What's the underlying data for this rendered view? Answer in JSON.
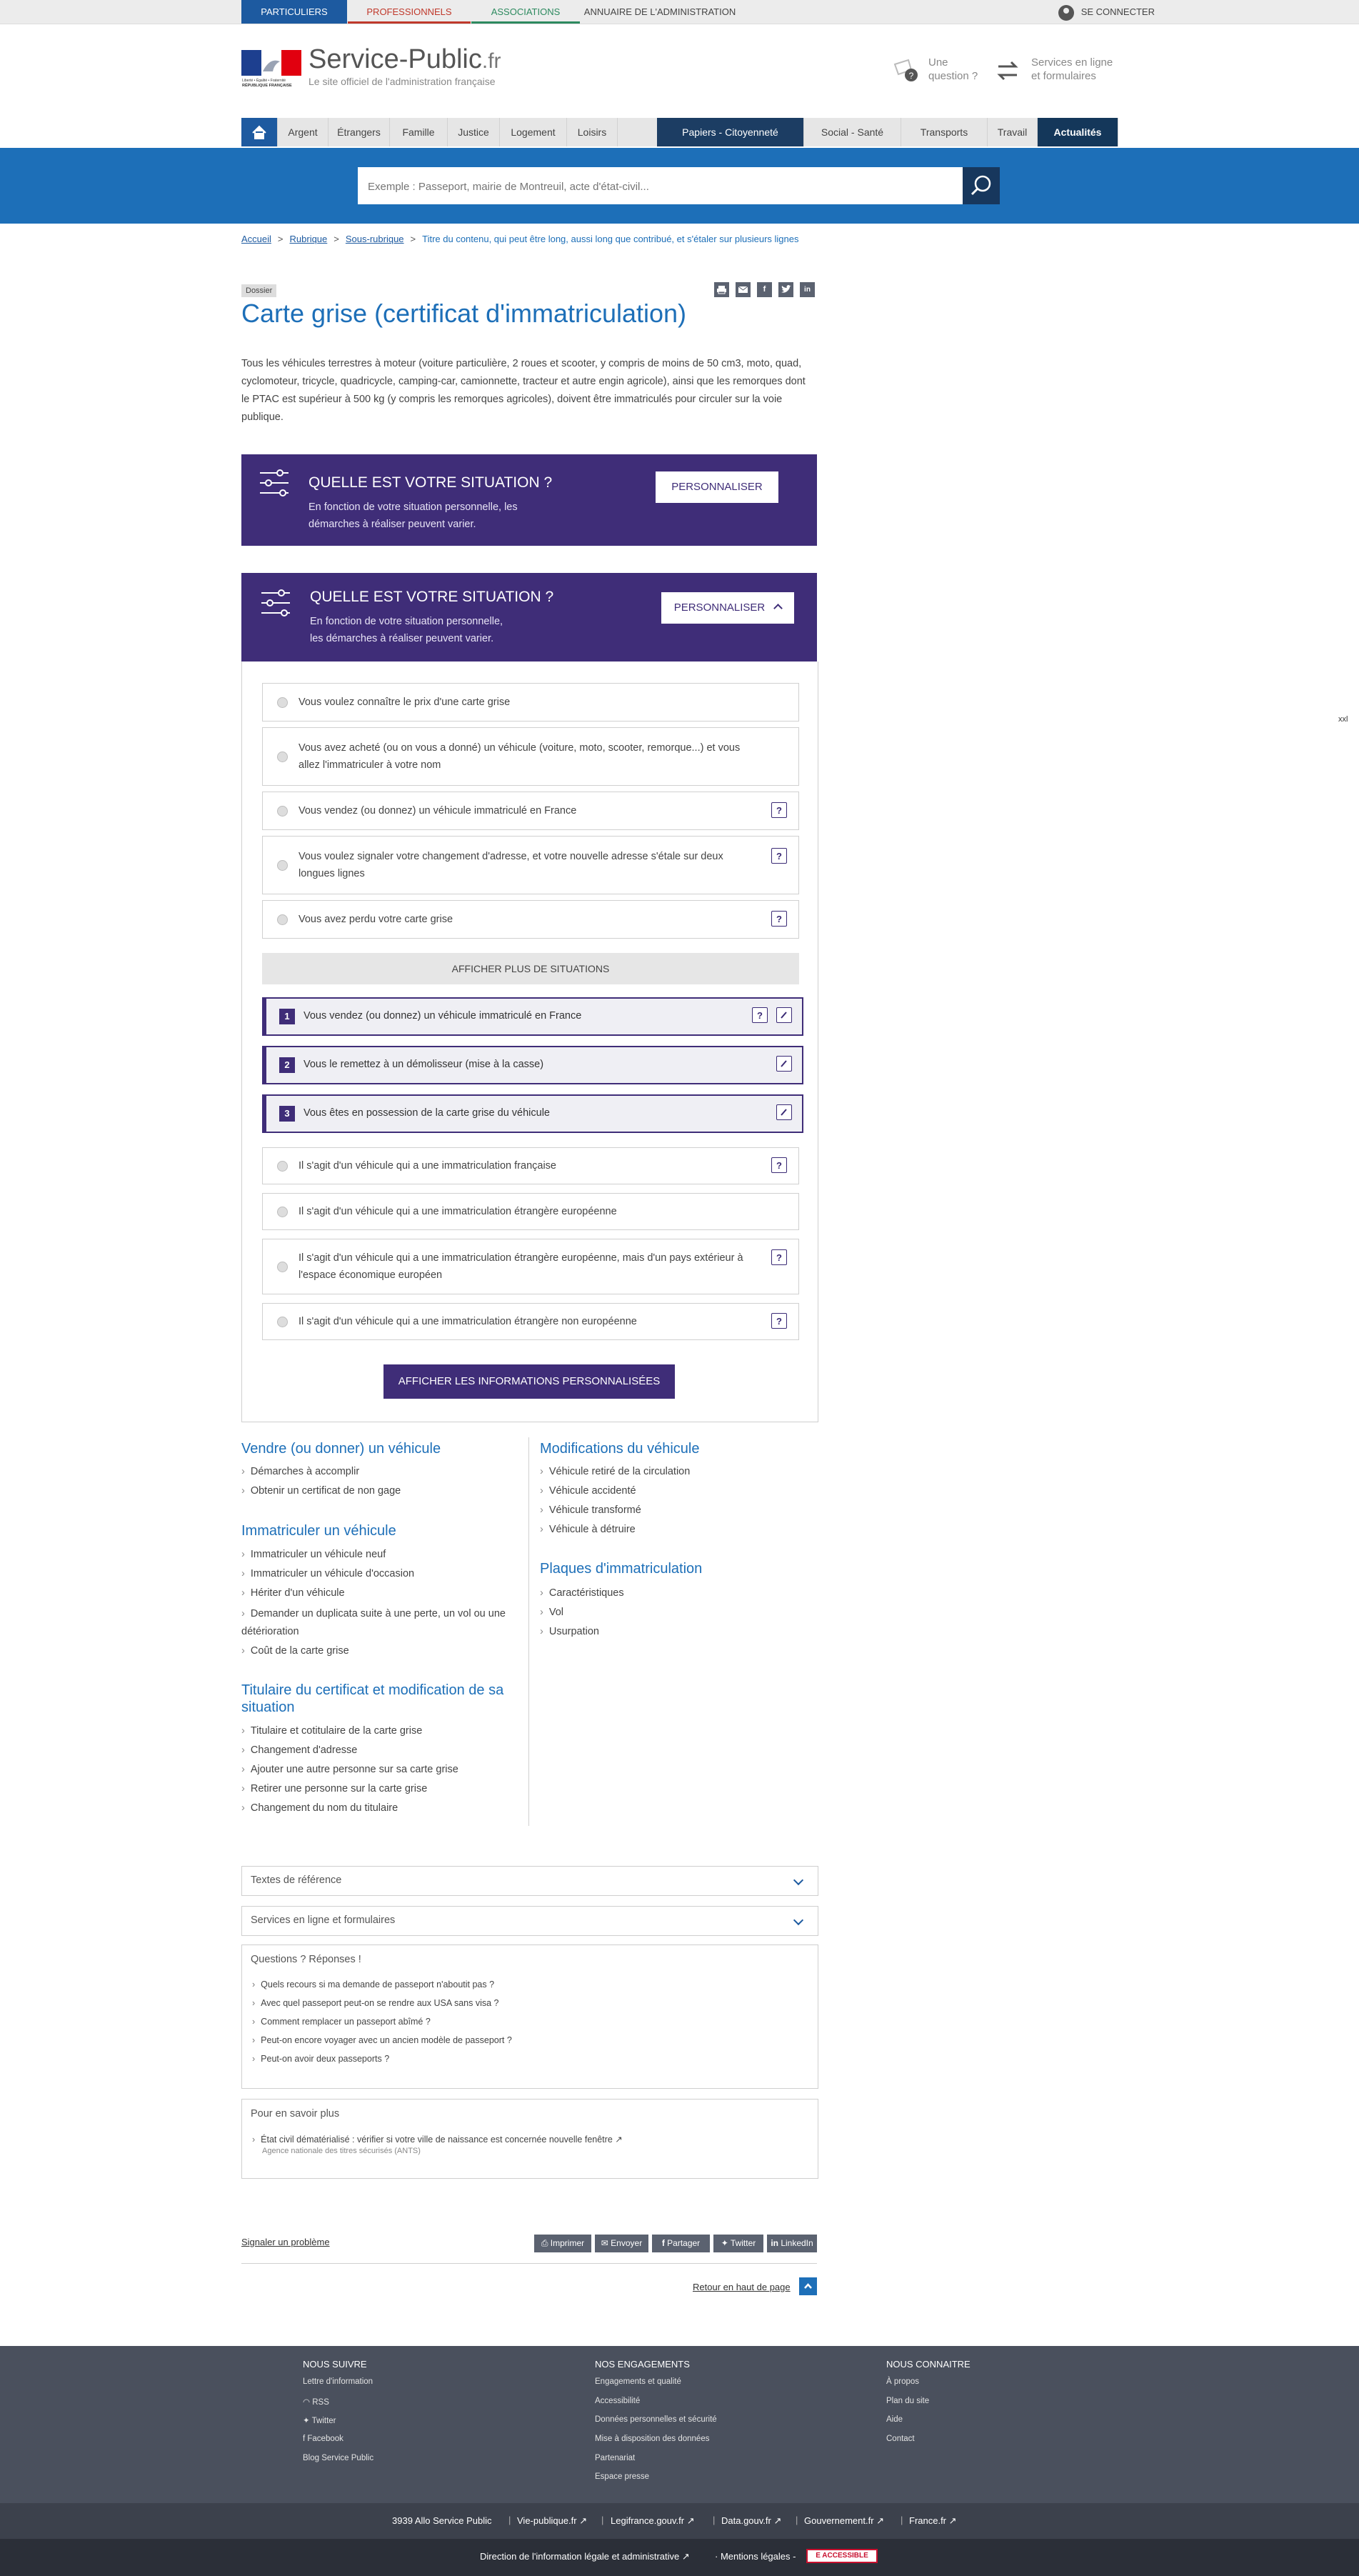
{
  "topbar": {
    "tabs": [
      "PARTICULIERS",
      "PROFESSIONNELS",
      "ASSOCIATIONS",
      "ANNUAIRE DE L'ADMINISTRATION"
    ],
    "login": "SE CONNECTER"
  },
  "header": {
    "site_name": "Service-Public",
    "site_tld": ".fr",
    "tagline": "Le site officiel de l'administration française",
    "marianne_text": "Liberté • Égalité • Fraternité\nRÉPUBLIQUE FRANÇAISE",
    "question_link": "Une question ?",
    "services_link": "Services en ligne et formulaires"
  },
  "nav": [
    "Argent",
    "Étrangers",
    "Famille",
    "Justice",
    "Logement",
    "Loisirs",
    "Papiers - Citoyenneté",
    "Social - Santé",
    "Transports",
    "Travail",
    "Actualités"
  ],
  "search": {
    "placeholder": "Exemple : Passeport, mairie de Montreuil, acte d'état-civil..."
  },
  "breadcrumb": {
    "items": [
      "Accueil",
      "Rubrique",
      "Sous-rubrique"
    ],
    "current": "Titre du contenu, qui peut être long, aussi long que contribué, et s'étaler sur plusieurs lignes"
  },
  "page": {
    "tag": "Dossier",
    "title": "Carte grise (certificat d'immatriculation)",
    "intro": "Tous les véhicules terrestres à moteur (voiture particulière, 2 roues et scooter, y compris de moins de 50 cm3, moto, quad, cyclomoteur, tricycle, quadricycle, camping-car, camionnette, tracteur et autre engin agricole), ainsi que les remorques dont le PTAC est supérieur à 500 kg (y compris les remorques agricoles), doivent être immatriculés pour circuler sur la voie publique.",
    "text_size": "xxl"
  },
  "situation_panel": {
    "title": "QUELLE EST VOTRE SITUATION ?",
    "text_line1": "En fonction de votre situation personnelle, les",
    "text_line2": "démarches à réaliser peuvent varier.",
    "button": "PERSONNALISER"
  },
  "situation_panel_open": {
    "title": "QUELLE EST VOTRE SITUATION ?",
    "text_line1": "En fonction de votre situation personnelle,",
    "text_line2": "les démarches à réaliser peuvent varier.",
    "button": "PERSONNALISER"
  },
  "options": [
    "Vous voulez connaître le prix d'une carte grise",
    "Vous avez acheté (ou on vous a donné) un véhicule (voiture, moto, scooter, remorque...) et vous allez l'immatriculer à votre nom",
    "Vous vendez (ou donnez) un véhicule immatriculé en France",
    "Vous voulez signaler votre changement d'adresse, et votre nouvelle adresse s'étale sur deux longues lignes",
    "Vous avez perdu votre carte grise"
  ],
  "more_situations": "AFFICHER PLUS DE SITUATIONS",
  "selected": [
    {
      "num": "1",
      "text": "Vous vendez (ou donnez) un véhicule immatriculé en France"
    },
    {
      "num": "2",
      "text": "Vous le remettez à un démolisseur (mise à la casse)"
    },
    {
      "num": "3",
      "text": "Vous êtes en possession de la carte grise du véhicule"
    }
  ],
  "sub_options": [
    "Il s'agit d'un véhicule qui a une immatriculation française",
    "Il s'agit d'un véhicule qui a une immatriculation étrangère européenne",
    "Il s'agit d'un véhicule qui a une immatriculation étrangère européenne, mais d'un pays extérieur à l'espace économique européen",
    "Il s'agit d'un véhicule qui a une immatriculation étrangère non européenne"
  ],
  "show_info": "AFFICHER LES INFORMATIONS PERSONNALISÉES",
  "icons": {
    "help": "?",
    "edit": "pencil-icon"
  },
  "sections_left": [
    {
      "title": "Vendre (ou donner) un véhicule",
      "links": [
        "Démarches à accomplir",
        "Obtenir un certificat de non gage"
      ]
    },
    {
      "title": "Immatriculer un véhicule",
      "links": [
        "Immatriculer un véhicule neuf",
        "Immatriculer un véhicule d'occasion",
        "Hériter d'un véhicule",
        "Demander un duplicata suite à une perte, un vol ou une détérioration",
        "Coût de la carte grise"
      ]
    },
    {
      "title": "Titulaire du certificat et modification de sa situation",
      "links": [
        "Titulaire et cotitulaire de la carte grise",
        "Changement d'adresse",
        "Ajouter une autre personne sur sa carte grise",
        "Retirer une personne sur la carte grise",
        "Changement du nom du titulaire"
      ]
    }
  ],
  "sections_right": [
    {
      "title": "Modifications du véhicule",
      "links": [
        "Véhicule retiré de la circulation",
        "Véhicule accidenté",
        "Véhicule transformé",
        "Véhicule à détruire"
      ]
    },
    {
      "title": "Plaques d'immatriculation",
      "links": [
        "Caractéristiques",
        "Vol",
        "Usurpation"
      ]
    }
  ],
  "accordions": [
    "Textes de référence",
    "Services en ligne et formulaires"
  ],
  "qa": {
    "title": "Questions ? Réponses !",
    "items": [
      "Quels recours si ma demande de passeport n'aboutit pas ?",
      "Avec quel passeport peut-on se rendre aux USA sans visa ?",
      "Comment remplacer un passeport abîmé ?",
      "Peut-on encore voyager avec un ancien modèle de passeport ?",
      "Peut-on avoir deux passeports ?"
    ]
  },
  "more": {
    "title": "Pour en savoir plus",
    "link": "État civil dématérialisé : vérifier si votre ville de naissance est concernée nouvelle fenêtre",
    "source": "Agence nationale des titres sécurisés (ANTS)"
  },
  "report": "Signaler un problème",
  "share": [
    "Imprimer",
    "Envoyer",
    "Partager",
    "Twitter",
    "LinkedIn"
  ],
  "back_to_top": "Retour en haut de page",
  "footer": {
    "follow_title": "NOUS SUIVRE",
    "follow": [
      "Lettre d'information",
      "RSS",
      "Twitter",
      "Facebook",
      "Blog Service Public"
    ],
    "engage_title": "NOS ENGAGEMENTS",
    "engage": [
      "Engagements et qualité",
      "Accessibilité",
      "Données personnelles et sécurité",
      "Mise à disposition des données",
      "Partenariat",
      "Espace presse"
    ],
    "know_title": "NOUS CONNAITRE",
    "know": [
      "À propos",
      "Plan du site",
      "Aide",
      "Contact"
    ],
    "partners": [
      "3939 Allo Service Public",
      "Vie-publique.fr",
      "Legifrance.gouv.fr",
      "Data.gouv.fr",
      "Gouvernement.fr",
      "France.fr"
    ],
    "dila": "Direction de l'information légale et administrative",
    "legal": "Mentions légales -",
    "badge": "E ACCESSIBLE"
  },
  "colors": {
    "primary": "#1d6fb8",
    "dark": "#14375a",
    "purple": "#3f2d78",
    "footer": "#4a505d"
  }
}
